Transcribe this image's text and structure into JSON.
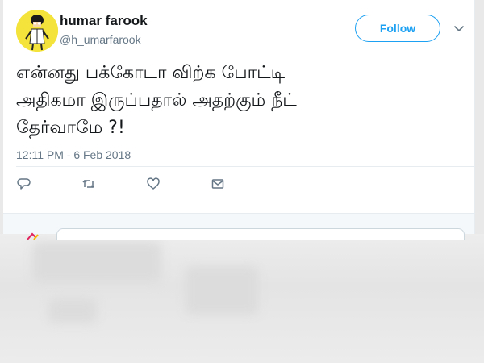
{
  "user": {
    "name": "humar farook",
    "handle": "@h_umarfarook"
  },
  "follow_label": "Follow",
  "tweet": {
    "lines": [
      "என்னது பக்கோடா விற்க போட்டி",
      "அதிகமா இருப்பதால் அதற்கும் நீட்",
      "தேர்வாமே ?!"
    ],
    "timestamp": "12:11 PM - 6 Feb 2018"
  },
  "actions": [
    "reply-icon",
    "retweet-icon",
    "like-icon",
    "message-icon"
  ],
  "colors": {
    "accent": "#1da1f2",
    "muted": "#657786",
    "text": "#14171a",
    "avatar_bg": "#f3e33a"
  }
}
